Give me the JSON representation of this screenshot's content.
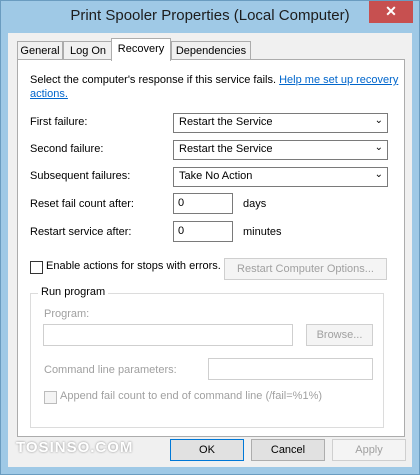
{
  "window": {
    "title": "Print Spooler Properties (Local Computer)",
    "close_glyph": "✕"
  },
  "tabs": [
    "General",
    "Log On",
    "Recovery",
    "Dependencies"
  ],
  "intro": {
    "text": "Select the computer's response if this service fails.",
    "link": "Help me set up recovery actions."
  },
  "first_failure": {
    "label": "First failure:",
    "value": "Restart the Service"
  },
  "second_failure": {
    "label": "Second failure:",
    "value": "Restart the Service"
  },
  "subsequent_failures": {
    "label": "Subsequent failures:",
    "value": "Take No Action"
  },
  "reset_count": {
    "label": "Reset fail count after:",
    "value": "0",
    "unit": "days"
  },
  "restart_service": {
    "label": "Restart service after:",
    "value": "0",
    "unit": "minutes"
  },
  "enable_actions": {
    "label": "Enable actions for stops with errors.",
    "checked": false
  },
  "restart_computer_button": "Restart Computer Options...",
  "run_program": {
    "group_title": "Run program",
    "program_label": "Program:",
    "program_value": "",
    "browse_button": "Browse...",
    "params_label": "Command line parameters:",
    "params_value": "",
    "append_label": "Append fail count to end of command line (/fail=%1%)"
  },
  "buttons": {
    "ok": "OK",
    "cancel": "Cancel",
    "apply": "Apply"
  },
  "watermark": "TOSINSO.COM",
  "combo_arrow": "⌄"
}
